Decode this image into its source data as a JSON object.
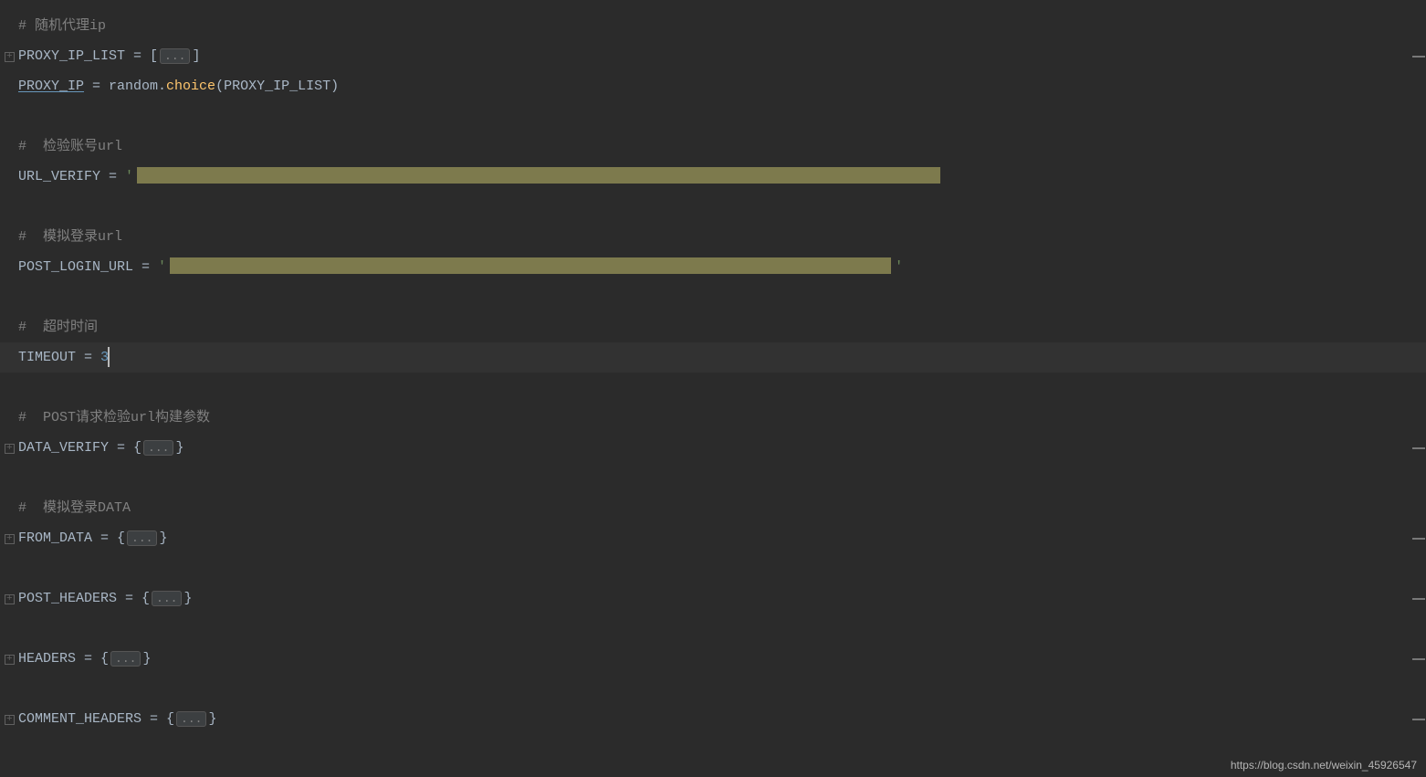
{
  "lines": {
    "comment_proxy": "# 随机代理ip",
    "proxy_ip_list_var": "PROXY_IP_LIST",
    "proxy_ip_list_eq": " = [",
    "proxy_ip_list_close": "]",
    "proxy_ip_var": "PROXY_IP",
    "proxy_ip_eq": " = ",
    "random_mod": "random.",
    "choice_fn": "choice",
    "choice_args_open": "(",
    "choice_args_var": "PROXY_IP_LIST",
    "choice_args_close": ")",
    "comment_verify": "#  检验账号url",
    "url_verify_var": "URL_VERIFY",
    "url_verify_eq": " = ",
    "url_verify_str_open": "'",
    "comment_login": "#  模拟登录url",
    "post_login_var": "POST_LOGIN_URL",
    "post_login_eq": " = ",
    "post_login_str_open": "'",
    "post_login_str_close": "'",
    "comment_timeout": "#  超时时间",
    "timeout_var": "TIMEOUT",
    "timeout_eq": " = ",
    "timeout_val": "3",
    "comment_data_verify": "#  POST请求检验url构建参数",
    "data_verify_var": "DATA_VERIFY",
    "data_verify_eq": " = {",
    "data_verify_close": "}",
    "comment_from_data": "#  模拟登录DATA",
    "from_data_var": "FROM_DATA",
    "from_data_eq": " = {",
    "from_data_close": "}",
    "post_headers_var": "POST_HEADERS",
    "post_headers_eq": " = {",
    "post_headers_close": "}",
    "headers_var": "HEADERS",
    "headers_eq": " = {",
    "headers_close": "}",
    "comment_headers_var": "COMMENT_HEADERS",
    "comment_headers_eq": " = {",
    "comment_headers_close": "}",
    "folded_text": "..."
  },
  "watermark": "https://blog.csdn.net/weixin_45926547"
}
